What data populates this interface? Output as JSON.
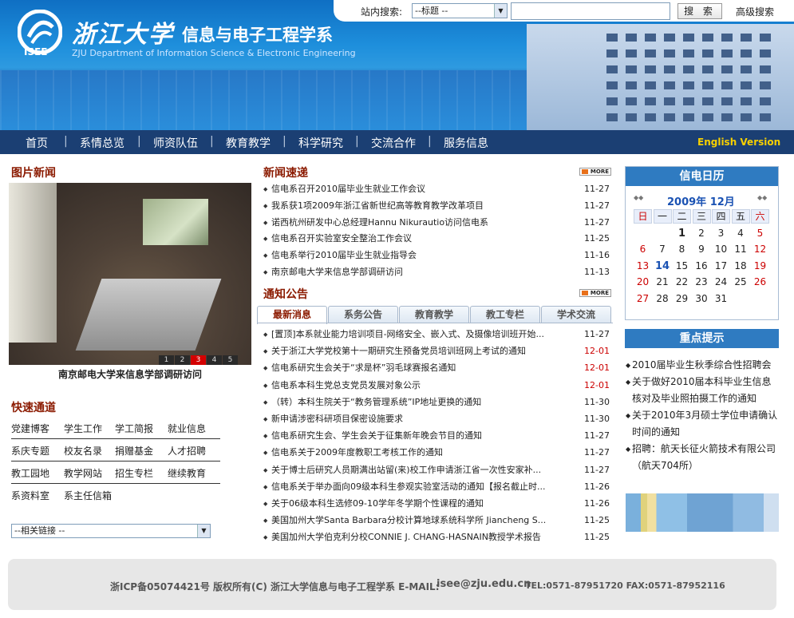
{
  "header": {
    "logo_isee": "ISEE",
    "logo_cn_main": "浙江大学",
    "logo_cn_sub": "信息与电子工程学系",
    "logo_en": "ZJU Department of Information Science & Electronic Engineering",
    "search_label": "站内搜索:",
    "search_select_value": "--标题 --",
    "search_button": "搜 索",
    "advanced_search": "高级搜索"
  },
  "nav": {
    "items": [
      "首页",
      "系情总览",
      "师资队伍",
      "教育教学",
      "科学研究",
      "交流合作",
      "服务信息"
    ],
    "separator": "|",
    "english": "English Version"
  },
  "photo_news": {
    "title": "图片新闻",
    "pages": [
      "1",
      "2",
      "3",
      "4",
      "5"
    ],
    "active_page": "3",
    "caption": "南京邮电大学来信息学部调研访问"
  },
  "quick_links": {
    "title": "快速通道",
    "rows": [
      [
        "党建博客",
        "学生工作",
        "学工简报",
        "就业信息"
      ],
      [
        "系庆专题",
        "校友名录",
        "捐赠基金",
        "人才招聘"
      ],
      [
        "教工园地",
        "教学网站",
        "招生专栏",
        "继续教育"
      ],
      [
        "系资料室",
        "系主任信箱"
      ]
    ],
    "related_select": "--相关链接 --"
  },
  "news": {
    "title": "新闻速递",
    "more": "MORE",
    "items": [
      {
        "title": "信电系召开2010届毕业生就业工作会议",
        "date": "11-27"
      },
      {
        "title": "我系获1项2009年浙江省新世纪高等教育教学改革项目",
        "date": "11-27"
      },
      {
        "title": "诺西杭州研发中心总经理Hannu Nikurautio访问信电系",
        "date": "11-27"
      },
      {
        "title": "信电系召开实验室安全整治工作会议",
        "date": "11-25"
      },
      {
        "title": "信电系举行2010届毕业生就业指导会",
        "date": "11-16"
      },
      {
        "title": "南京邮电大学来信息学部调研访问",
        "date": "11-13"
      }
    ]
  },
  "notices": {
    "title": "通知公告",
    "more": "MORE",
    "tabs": [
      "最新消息",
      "系务公告",
      "教育教学",
      "教工专栏",
      "学术交流"
    ],
    "items": [
      {
        "title": "[置顶]本系就业能力培训项目-网络安全、嵌入式、及摄像培训班开始...",
        "date": "11-27",
        "red": false
      },
      {
        "title": "关于浙江大学党校第十一期研究生预备党员培训班网上考试的通知",
        "date": "12-01",
        "red": true
      },
      {
        "title": "信电系研究生会关于“求是杯”羽毛球赛报名通知",
        "date": "12-01",
        "red": true
      },
      {
        "title": "信电系本科生党总支党员发展对象公示",
        "date": "12-01",
        "red": true
      },
      {
        "title": "（转）本科生院关于“教务管理系统”IP地址更换的通知",
        "date": "11-30",
        "red": false
      },
      {
        "title": "新申请涉密科研项目保密设施要求",
        "date": "11-30",
        "red": false
      },
      {
        "title": "信电系研究生会、学生会关于征集新年晚会节目的通知",
        "date": "11-27",
        "red": false
      },
      {
        "title": "信电系关于2009年度教职工考核工作的通知",
        "date": "11-27",
        "red": false
      },
      {
        "title": "关于博士后研究人员期满出站留(来)校工作申请浙江省一次性安家补...",
        "date": "11-27",
        "red": false
      },
      {
        "title": "信电系关于举办面向09级本科生参观实验室活动的通知【报名截止时...",
        "date": "11-26",
        "red": false
      },
      {
        "title": "关于06级本科生选修09-10学年冬学期个性课程的通知",
        "date": "11-26",
        "red": false
      },
      {
        "title": "美国加州大学Santa Barbara分校计算地球系统科学所 Jiancheng S...",
        "date": "11-25",
        "red": false
      },
      {
        "title": "美国加州大学伯克利分校CONNIE J. CHANG-HASNAIN教授学术报告",
        "date": "11-25",
        "red": false
      }
    ]
  },
  "calendar": {
    "title": "信电日历",
    "prev": "◆◆",
    "next": "◆◆",
    "month_label": "2009年 12月",
    "weekdays": [
      "日",
      "一",
      "二",
      "三",
      "四",
      "五",
      "六"
    ],
    "days": [
      [
        "",
        "",
        "1",
        "2",
        "3",
        "4",
        "5"
      ],
      [
        "6",
        "7",
        "8",
        "9",
        "10",
        "11",
        "12"
      ],
      [
        "13",
        "14",
        "15",
        "16",
        "17",
        "18",
        "19"
      ],
      [
        "20",
        "21",
        "22",
        "23",
        "24",
        "25",
        "26"
      ],
      [
        "27",
        "28",
        "29",
        "30",
        "31",
        "",
        ""
      ]
    ],
    "today": "14",
    "weekend_color": "#cc0000",
    "accent": "#2f7bc1"
  },
  "tips": {
    "title": "重点提示",
    "items": [
      "2010届毕业生秋季综合性招聘会",
      "关于做好2010届本科毕业生信息核对及毕业照拍摄工作的通知",
      "关于2010年3月硕士学位申请确认时间的通知",
      "招聘：航天长征火箭技术有限公司（航天704所）"
    ]
  },
  "footer": {
    "left": "浙ICP备05074421号 版权所有(C) 浙江大学信息与电子工程学系 E-MAIL:",
    "email": "isee@zju.edu.cn",
    "right": "TEL:0571-87951720 FAX:0571-87952116"
  }
}
